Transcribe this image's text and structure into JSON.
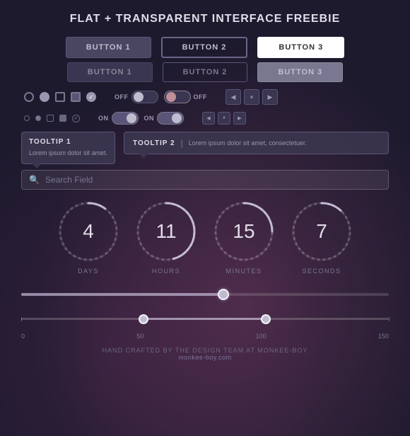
{
  "title": "FLAT + TRANSPARENT INTERFACE FREEBIE",
  "buttons": {
    "row1": [
      {
        "label": "BUTTON 1",
        "style": "btn-1"
      },
      {
        "label": "BUTTON 2",
        "style": "btn-2"
      },
      {
        "label": "BUTTON 3",
        "style": "btn-3"
      }
    ],
    "row2": [
      {
        "label": "BUTTON 1",
        "style": "btn-dim-1"
      },
      {
        "label": "BUTTON 2",
        "style": "btn-dim-2"
      },
      {
        "label": "BUTTON 3",
        "style": "btn-dim-3"
      }
    ]
  },
  "toggles": [
    {
      "label": "OFF",
      "state": "off"
    },
    {
      "label": "OFF",
      "state": "off"
    },
    {
      "label": "ON",
      "state": "on"
    },
    {
      "label": "ON",
      "state": "on"
    }
  ],
  "tooltips": {
    "tooltip1": {
      "title": "TOOLTIP 1",
      "text": "Lorem ipsum dolor sit amet."
    },
    "tooltip2": {
      "title": "TOOLTIP 2",
      "text": "Lorem ipsum dolor sit amet, consectetuer."
    }
  },
  "search": {
    "placeholder": "Search Field",
    "value": ""
  },
  "timers": [
    {
      "number": "4",
      "label": "DAYS",
      "progress": 0.11
    },
    {
      "number": "11",
      "label": "HOURS",
      "progress": 0.46
    },
    {
      "number": "15",
      "label": "MINUTES",
      "progress": 0.25
    },
    {
      "number": "7",
      "label": "SECONDS",
      "progress": 0.12
    }
  ],
  "slider1": {
    "value": 55,
    "min": 0,
    "max": 100,
    "fill_pct": 55
  },
  "range_slider": {
    "min_val": 50,
    "max_val": 100,
    "abs_min": 0,
    "abs_max": 150,
    "labels": [
      "0",
      "50",
      "100",
      "150"
    ]
  },
  "footer": {
    "credit": "HAND CRAFTED BY THE DESIGN TEAM AT MONKEE-BOY",
    "url": "monkee-boy.com"
  }
}
